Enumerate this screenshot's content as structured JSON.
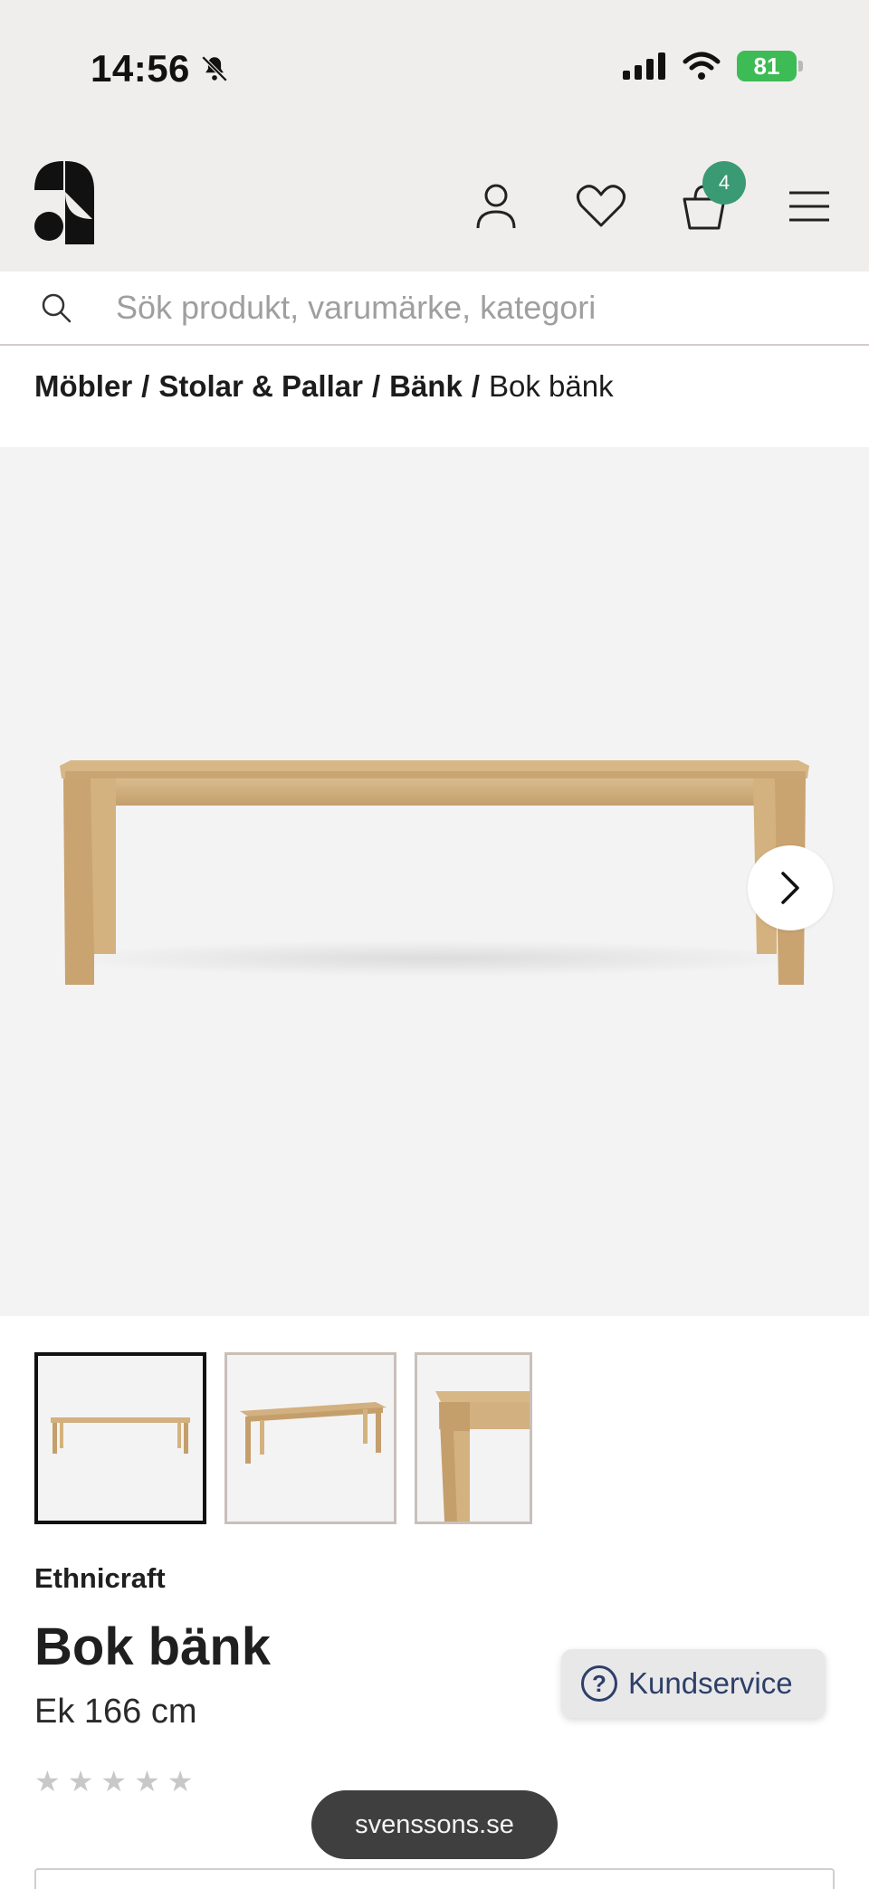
{
  "status_bar": {
    "time": "14:56",
    "battery": "81"
  },
  "header": {
    "cart_count": "4"
  },
  "search": {
    "placeholder": "Sök produkt, varumärke, kategori"
  },
  "breadcrumb": {
    "items": [
      "Möbler",
      "Stolar & Pallar",
      "Bänk"
    ],
    "separator": "/",
    "current": "Bok bänk"
  },
  "product": {
    "brand": "Ethnicraft",
    "name": "Bok bänk",
    "variant": "Ek 166 cm",
    "rating_stars": 0,
    "rating_max": 5
  },
  "support": {
    "label": "Kundservice",
    "icon": "?"
  },
  "browser": {
    "domain": "svenssons.se"
  },
  "colors": {
    "header_bg": "#efeeec",
    "badge": "#3a9a73",
    "battery": "#3dbb55",
    "support_text": "#2d3f6a"
  }
}
